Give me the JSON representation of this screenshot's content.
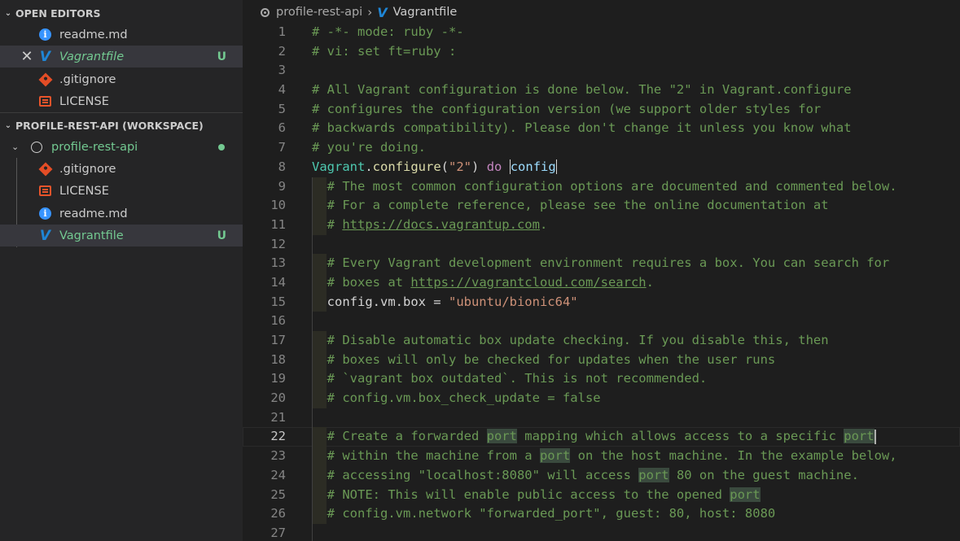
{
  "sidebar": {
    "open_editors_label": "OPEN EDITORS",
    "open_editors": [
      {
        "label": "readme.md",
        "icon": "info-icon"
      },
      {
        "label": "Vagrantfile",
        "icon": "vagrant-icon",
        "badge": "U",
        "active": true
      },
      {
        "label": ".gitignore",
        "icon": "git-icon"
      },
      {
        "label": "LICENSE",
        "icon": "license-icon"
      }
    ],
    "workspace_label": "PROFILE-REST-API (WORKSPACE)",
    "folder": {
      "label": "profile-rest-api"
    },
    "files": [
      {
        "label": ".gitignore",
        "icon": "git-icon"
      },
      {
        "label": "LICENSE",
        "icon": "license-icon"
      },
      {
        "label": "readme.md",
        "icon": "info-icon"
      },
      {
        "label": "Vagrantfile",
        "icon": "vagrant-icon",
        "badge": "U",
        "active": true
      }
    ],
    "close_glyph": "✕"
  },
  "breadcrumb": {
    "folder": "profile-rest-api",
    "file": "Vagrantfile",
    "separator": "›"
  },
  "editor": {
    "current_line": 22,
    "lines": [
      {
        "n": "1",
        "t": "# -*- mode: ruby -*-"
      },
      {
        "n": "2",
        "t": "# vi: set ft=ruby :"
      },
      {
        "n": "3",
        "t": ""
      },
      {
        "n": "4",
        "t": "# All Vagrant configuration is done below. The \"2\" in Vagrant.configure"
      },
      {
        "n": "5",
        "t": "# configures the configuration version (we support older styles for"
      },
      {
        "n": "6",
        "t": "# backwards compatibility). Please don't change it unless you know what"
      },
      {
        "n": "7",
        "t": "# you're doing."
      },
      {
        "n": "8",
        "t": "Vagrant.configure(\"2\") do |config|"
      },
      {
        "n": "9",
        "t": "  # The most common configuration options are documented and commented below."
      },
      {
        "n": "10",
        "t": "  # For a complete reference, please see the online documentation at"
      },
      {
        "n": "11",
        "t": "  # https://docs.vagrantup.com."
      },
      {
        "n": "12",
        "t": ""
      },
      {
        "n": "13",
        "t": "  # Every Vagrant development environment requires a box. You can search for"
      },
      {
        "n": "14",
        "t": "  # boxes at https://vagrantcloud.com/search."
      },
      {
        "n": "15",
        "t": "  config.vm.box = \"ubuntu/bionic64\""
      },
      {
        "n": "16",
        "t": ""
      },
      {
        "n": "17",
        "t": "  # Disable automatic box update checking. If you disable this, then"
      },
      {
        "n": "18",
        "t": "  # boxes will only be checked for updates when the user runs"
      },
      {
        "n": "19",
        "t": "  # `vagrant box outdated`. This is not recommended."
      },
      {
        "n": "20",
        "t": "  # config.vm.box_check_update = false"
      },
      {
        "n": "21",
        "t": ""
      },
      {
        "n": "22",
        "t": "  # Create a forwarded port mapping which allows access to a specific port"
      },
      {
        "n": "23",
        "t": "  # within the machine from a port on the host machine. In the example below,"
      },
      {
        "n": "24",
        "t": "  # accessing \"localhost:8080\" will access port 80 on the guest machine."
      },
      {
        "n": "25",
        "t": "  # NOTE: This will enable public access to the opened port"
      },
      {
        "n": "26",
        "t": "  # config.vm.network \"forwarded_port\", guest: 80, host: 8080"
      },
      {
        "n": "27",
        "t": ""
      }
    ]
  },
  "colors": {
    "comment": "#6a9955",
    "string": "#ce9178",
    "keyword": "#c586c0",
    "type": "#4ec9b0",
    "untracked": "#73c991",
    "vagrant_blue": "#1f86d6"
  }
}
